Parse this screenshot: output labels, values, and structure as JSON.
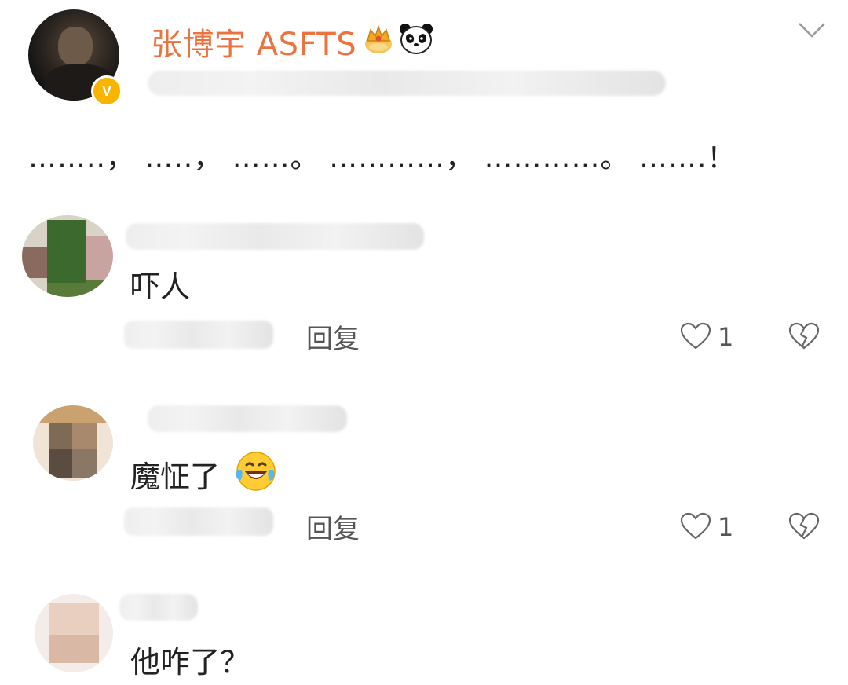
{
  "post": {
    "author": "张博宇 ASFTS",
    "badges": [
      "crown-icon",
      "panda-icon"
    ],
    "verified_badge": "V",
    "text": "……..，  …..，  ……。  …………，  …………。  …….！"
  },
  "comments": [
    {
      "text": "吓人",
      "reply_label": "回复",
      "likes": "1"
    },
    {
      "text": "魔怔了",
      "emoji": "laughing-crying-emoji",
      "reply_label": "回复",
      "likes": "1"
    },
    {
      "text": "他咋了？"
    }
  ],
  "colors": {
    "accent_username": "#eb7340",
    "verified": "#f7b500"
  }
}
